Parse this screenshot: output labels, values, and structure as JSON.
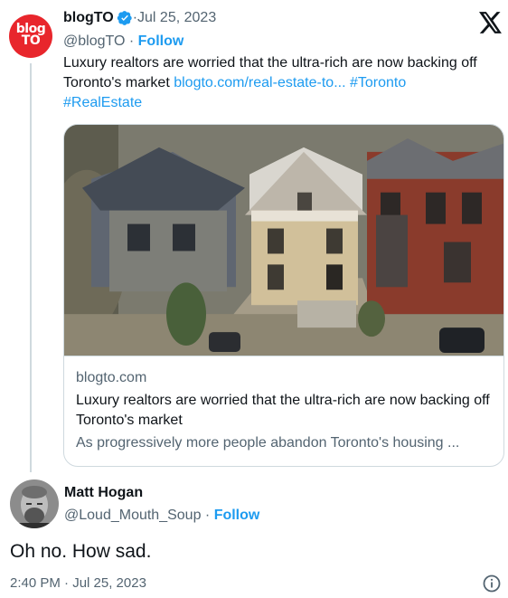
{
  "parent_tweet": {
    "author_name": "blogTO",
    "avatar_text_line1": "blog",
    "avatar_text_line2": "TO",
    "date_prefix": " · ",
    "date": "Jul 25, 2023",
    "handle": "@blogTO",
    "handle_sep": " · ",
    "follow_label": "Follow",
    "text": "Luxury realtors are worried that the ultra-rich are now backing off Toronto's market ",
    "link": "blogto.com/real-estate-to...",
    "hashtag1": "#Toronto",
    "hashtag2": "#RealEstate"
  },
  "link_card": {
    "domain": "blogto.com",
    "title": "Luxury realtors are worried that the ultra-rich are now backing off Toronto's market",
    "description": "As progressively more people abandon Toronto's housing ..."
  },
  "reply_tweet": {
    "author_name": "Matt Hogan",
    "handle": "@Loud_Mouth_Soup",
    "handle_sep": " · ",
    "follow_label": "Follow",
    "text": "Oh no. How sad.",
    "timestamp": "2:40 PM · Jul 25, 2023"
  },
  "icons": {
    "brand": "x-logo-icon",
    "verified": "verified-badge-icon",
    "info": "info-icon"
  },
  "colors": {
    "accent": "#1d9bf0",
    "text": "#0f1419",
    "muted": "#536471",
    "border": "#cfd9de",
    "blogto_red": "#e8262c"
  }
}
